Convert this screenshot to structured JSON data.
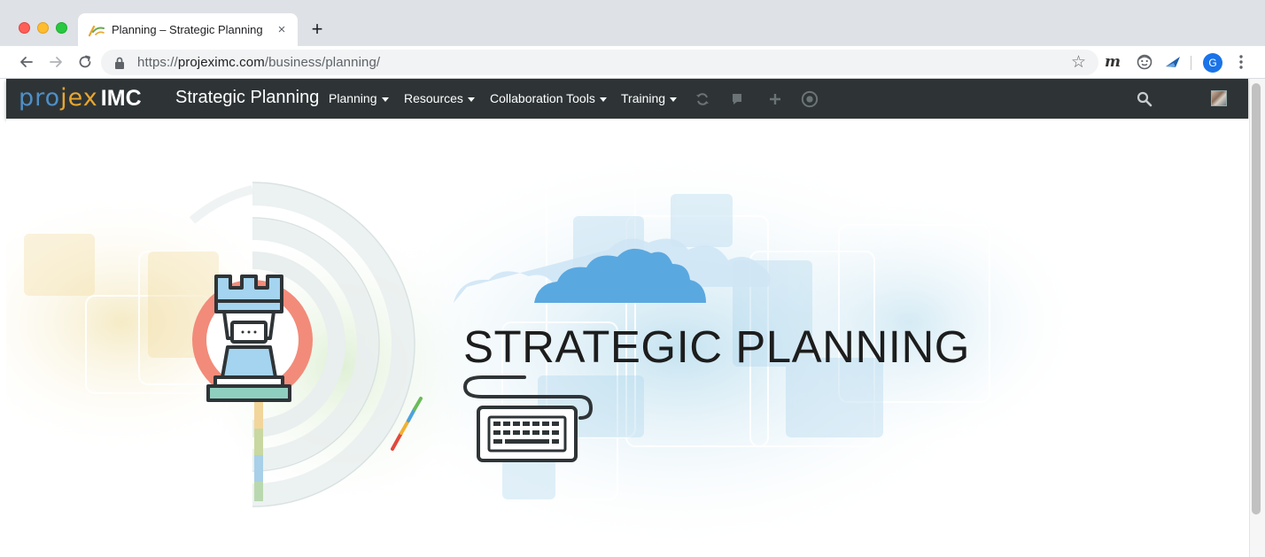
{
  "browser": {
    "tab_title": "Planning – Strategic Planning",
    "tab_close": "×",
    "new_tab": "+",
    "url_scheme": "https://",
    "url_host": "projeximc.com",
    "url_path": "/business/planning/",
    "profile_initial": "G",
    "extension_m": "m"
  },
  "site": {
    "brand_part1": "pro",
    "brand_part2": "jex",
    "brand_part3": "IMC",
    "title": "Strategic Planning",
    "menu": [
      {
        "label": "Planning"
      },
      {
        "label": "Resources"
      },
      {
        "label": "Collaboration Tools"
      },
      {
        "label": "Training"
      }
    ]
  },
  "hero": {
    "headline": "STRATEGIC PLANNING"
  },
  "colors": {
    "navbar": "#2e3436",
    "brand_blue": "#4f8fc7",
    "brand_orange": "#e8a62e"
  }
}
